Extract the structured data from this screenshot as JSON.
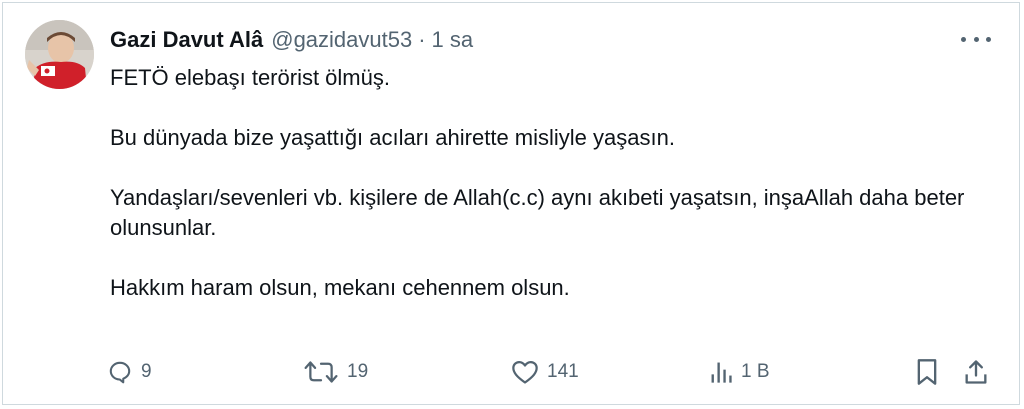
{
  "tweet": {
    "author_name": "Gazi Davut Alâ",
    "handle": "@gazidavut53",
    "separator": "·",
    "time": "1 sa",
    "paragraphs": [
      "FETÖ elebaşı terörist ölmüş.",
      "Bu dünyada bize yaşattığı acıları ahirette misliyle yaşasın.",
      "Yandaşları/sevenleri vb. kişilere de Allah(c.c) aynı akıbeti yaşatsın, inşaAllah daha beter olunsunlar.",
      "Hakkım haram olsun, mekanı cehennem olsun."
    ]
  },
  "actions": {
    "replies": "9",
    "retweets": "19",
    "likes": "141",
    "views": "1 B"
  },
  "icons": {
    "reply": "reply-icon",
    "retweet": "retweet-icon",
    "like": "heart-icon",
    "views": "views-icon",
    "bookmark": "bookmark-icon",
    "share": "share-icon",
    "more": "more-icon"
  },
  "colors": {
    "text": "#0f1419",
    "secondary": "#536471",
    "border": "#cfd9de"
  }
}
